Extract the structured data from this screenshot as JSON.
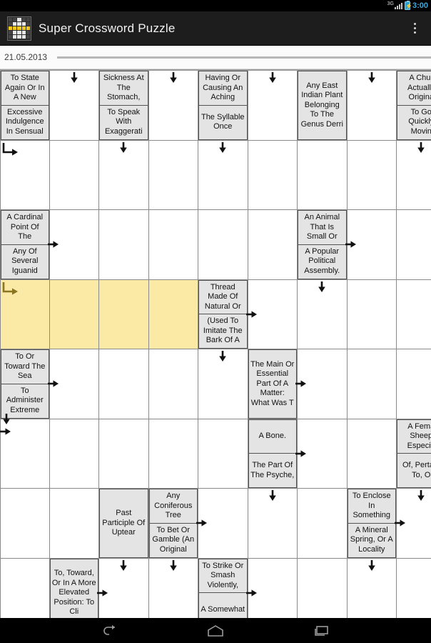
{
  "status_bar": {
    "network_label": "3G",
    "clock": "3:00",
    "signal_icon": "signal-bars-icon",
    "battery_icon": "battery-charging-icon"
  },
  "action_bar": {
    "app_icon": "crossword-grid-icon",
    "title": "Super Crossword Puzzle",
    "overflow_icon": "overflow-menu-icon"
  },
  "date_bar": {
    "date": "21.05.2013"
  },
  "colors": {
    "selection": "#fbe9a6",
    "clue_background": "#e4e4e4",
    "grid_line": "#8a8a8a",
    "action_bar": "#1d1d1d",
    "clock": "#3fa9dd"
  },
  "grid": {
    "columns": 9,
    "rows": 8,
    "cells": [
      {
        "r": 0,
        "c": 0,
        "type": "clue",
        "clue1": "To State Again Or In A New",
        "clue2": "Excessive Indulgence In Sensual"
      },
      {
        "r": 0,
        "c": 1,
        "type": "empty",
        "arrow": "down"
      },
      {
        "r": 0,
        "c": 2,
        "type": "clue",
        "clue1": "Sickness At The Stomach,",
        "clue2": "To Speak With Exaggerati"
      },
      {
        "r": 0,
        "c": 3,
        "type": "empty",
        "arrow": "down"
      },
      {
        "r": 0,
        "c": 4,
        "type": "clue",
        "clue1": "Having Or Causing An Aching",
        "clue2": "The Syllable Once"
      },
      {
        "r": 0,
        "c": 5,
        "type": "empty",
        "arrow": "down"
      },
      {
        "r": 0,
        "c": 6,
        "type": "clue",
        "clue1": "Any East Indian Plant Belonging To The Genus Derri",
        "clue2": ""
      },
      {
        "r": 0,
        "c": 7,
        "type": "empty",
        "arrow": "down"
      },
      {
        "r": 0,
        "c": 8,
        "type": "clue",
        "clue1": "A Chur Actually Origina",
        "clue2": "To Go Quickly Movin"
      },
      {
        "r": 1,
        "c": 0,
        "type": "empty",
        "arrow": "elbow-down-right"
      },
      {
        "r": 1,
        "c": 1,
        "type": "empty"
      },
      {
        "r": 1,
        "c": 2,
        "type": "empty",
        "arrow": "down"
      },
      {
        "r": 1,
        "c": 3,
        "type": "empty"
      },
      {
        "r": 1,
        "c": 4,
        "type": "empty",
        "arrow": "down"
      },
      {
        "r": 1,
        "c": 5,
        "type": "empty"
      },
      {
        "r": 1,
        "c": 6,
        "type": "empty"
      },
      {
        "r": 1,
        "c": 7,
        "type": "empty"
      },
      {
        "r": 1,
        "c": 8,
        "type": "empty",
        "arrow": "down"
      },
      {
        "r": 2,
        "c": 0,
        "type": "clue",
        "clue1": "A Cardinal Point Of The",
        "clue2": "Any Of Several Iguanid",
        "arrow": "right-outside"
      },
      {
        "r": 2,
        "c": 1,
        "type": "empty"
      },
      {
        "r": 2,
        "c": 2,
        "type": "empty"
      },
      {
        "r": 2,
        "c": 3,
        "type": "empty"
      },
      {
        "r": 2,
        "c": 4,
        "type": "empty"
      },
      {
        "r": 2,
        "c": 5,
        "type": "empty"
      },
      {
        "r": 2,
        "c": 6,
        "type": "clue",
        "clue1": "An Animal That Is Small Or",
        "clue2": "A Popular Political Assembly.",
        "arrow": "right-outside"
      },
      {
        "r": 2,
        "c": 7,
        "type": "empty"
      },
      {
        "r": 2,
        "c": 8,
        "type": "empty"
      },
      {
        "r": 3,
        "c": 0,
        "type": "selected",
        "arrow": "elbow-down-right-sel"
      },
      {
        "r": 3,
        "c": 1,
        "type": "selected"
      },
      {
        "r": 3,
        "c": 2,
        "type": "selected"
      },
      {
        "r": 3,
        "c": 3,
        "type": "selected"
      },
      {
        "r": 3,
        "c": 4,
        "type": "clue",
        "clue1": "Thread Made Of Natural Or",
        "clue2": "(Used To Imitate The Bark Of A",
        "arrow": "right-outside"
      },
      {
        "r": 3,
        "c": 5,
        "type": "empty"
      },
      {
        "r": 3,
        "c": 6,
        "type": "empty",
        "arrow": "down"
      },
      {
        "r": 3,
        "c": 7,
        "type": "empty"
      },
      {
        "r": 3,
        "c": 8,
        "type": "empty"
      },
      {
        "r": 4,
        "c": 0,
        "type": "clue",
        "clue1": "To Or Toward The Sea",
        "clue2": "To Administer Extreme",
        "arrow": "right-outside"
      },
      {
        "r": 4,
        "c": 1,
        "type": "empty"
      },
      {
        "r": 4,
        "c": 2,
        "type": "empty"
      },
      {
        "r": 4,
        "c": 3,
        "type": "empty"
      },
      {
        "r": 4,
        "c": 4,
        "type": "empty",
        "arrow": "down"
      },
      {
        "r": 4,
        "c": 5,
        "type": "clue",
        "clue1": "The Main Or Essential Part Of A Matter: What Was T",
        "clue2": "",
        "arrow": "right-outside"
      },
      {
        "r": 4,
        "c": 6,
        "type": "empty"
      },
      {
        "r": 4,
        "c": 7,
        "type": "empty"
      },
      {
        "r": 4,
        "c": 8,
        "type": "empty"
      },
      {
        "r": 5,
        "c": 0,
        "type": "empty",
        "arrow": "down-and-right"
      },
      {
        "r": 5,
        "c": 1,
        "type": "empty"
      },
      {
        "r": 5,
        "c": 2,
        "type": "empty"
      },
      {
        "r": 5,
        "c": 3,
        "type": "empty"
      },
      {
        "r": 5,
        "c": 4,
        "type": "empty"
      },
      {
        "r": 5,
        "c": 5,
        "type": "clue",
        "clue1": "A Bone.",
        "clue2": "The Part Of The Psyche,",
        "arrow": "right-outside"
      },
      {
        "r": 5,
        "c": 6,
        "type": "empty"
      },
      {
        "r": 5,
        "c": 7,
        "type": "empty"
      },
      {
        "r": 5,
        "c": 8,
        "type": "clue",
        "clue1": "A Fema Sheep Especia",
        "clue2": "Of, Pertain To, O"
      },
      {
        "r": 6,
        "c": 0,
        "type": "empty"
      },
      {
        "r": 6,
        "c": 1,
        "type": "empty"
      },
      {
        "r": 6,
        "c": 2,
        "type": "clue",
        "clue1": "Past Participle Of Uptear",
        "clue2": ""
      },
      {
        "r": 6,
        "c": 3,
        "type": "clue",
        "clue1": "Any Coniferous Tree",
        "clue2": "To Bet Or Gamble (An Original",
        "arrow": "right-outside"
      },
      {
        "r": 6,
        "c": 4,
        "type": "empty"
      },
      {
        "r": 6,
        "c": 5,
        "type": "empty",
        "arrow": "down"
      },
      {
        "r": 6,
        "c": 6,
        "type": "empty"
      },
      {
        "r": 6,
        "c": 7,
        "type": "clue",
        "clue1": "To Enclose In Something",
        "clue2": "A Mineral Spring, Or A Locality",
        "arrow": "right-outside"
      },
      {
        "r": 6,
        "c": 8,
        "type": "empty",
        "arrow": "down"
      },
      {
        "r": 7,
        "c": 0,
        "type": "empty"
      },
      {
        "r": 7,
        "c": 1,
        "type": "clue",
        "clue1": "To, Toward, Or In A More Elevated Position: To Cli",
        "clue2": "",
        "arrow": "right-outside"
      },
      {
        "r": 7,
        "c": 2,
        "type": "empty",
        "arrow": "down"
      },
      {
        "r": 7,
        "c": 3,
        "type": "empty",
        "arrow": "down"
      },
      {
        "r": 7,
        "c": 4,
        "type": "clue",
        "clue1": "To Strike Or Smash Violently,",
        "clue2": "A Somewhat",
        "arrow": "right-outside"
      },
      {
        "r": 7,
        "c": 5,
        "type": "empty"
      },
      {
        "r": 7,
        "c": 6,
        "type": "empty"
      },
      {
        "r": 7,
        "c": 7,
        "type": "empty",
        "arrow": "down"
      },
      {
        "r": 7,
        "c": 8,
        "type": "empty"
      }
    ]
  },
  "nav_bar": {
    "back_icon": "back-arrow-icon",
    "home_icon": "home-icon",
    "recents_icon": "recent-apps-icon"
  }
}
